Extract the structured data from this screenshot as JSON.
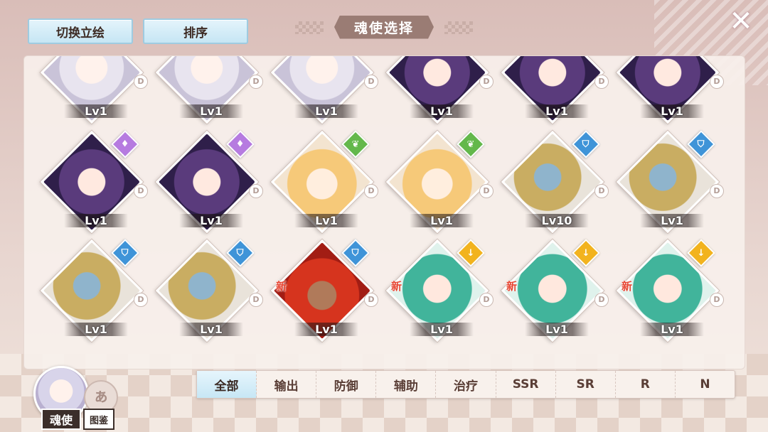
{
  "header": {
    "switch_portrait": "切换立绘",
    "sort": "排序",
    "title": "魂使选择",
    "close": "✕"
  },
  "cards": [
    {
      "level": "Lv1",
      "rank": "D",
      "style": "silver",
      "type": "",
      "type_icon": "",
      "new": ""
    },
    {
      "level": "Lv1",
      "rank": "D",
      "style": "silver",
      "type": "",
      "type_icon": "",
      "new": ""
    },
    {
      "level": "Lv1",
      "rank": "D",
      "style": "silver",
      "type": "",
      "type_icon": "",
      "new": ""
    },
    {
      "level": "Lv1",
      "rank": "D",
      "style": "purple",
      "type": "",
      "type_icon": "",
      "new": ""
    },
    {
      "level": "Lv1",
      "rank": "D",
      "style": "purple",
      "type": "",
      "type_icon": "",
      "new": ""
    },
    {
      "level": "Lv1",
      "rank": "D",
      "style": "purple",
      "type": "",
      "type_icon": "",
      "new": ""
    },
    {
      "level": "Lv1",
      "rank": "D",
      "style": "purple",
      "type": "purple",
      "type_icon": "droplet-icon",
      "new": ""
    },
    {
      "level": "Lv1",
      "rank": "D",
      "style": "purple",
      "type": "purple",
      "type_icon": "droplet-icon",
      "new": ""
    },
    {
      "level": "Lv1",
      "rank": "D",
      "style": "blonde",
      "type": "green",
      "type_icon": "leaf-icon",
      "new": ""
    },
    {
      "level": "Lv1",
      "rank": "D",
      "style": "blonde",
      "type": "green",
      "type_icon": "leaf-icon",
      "new": ""
    },
    {
      "level": "Lv10",
      "rank": "D",
      "style": "armor",
      "type": "blue",
      "type_icon": "shield-icon",
      "new": ""
    },
    {
      "level": "Lv1",
      "rank": "D",
      "style": "armor",
      "type": "blue",
      "type_icon": "shield-icon",
      "new": ""
    },
    {
      "level": "Lv1",
      "rank": "D",
      "style": "armor",
      "type": "blue",
      "type_icon": "shield-icon",
      "new": ""
    },
    {
      "level": "Lv1",
      "rank": "D",
      "style": "armor",
      "type": "blue",
      "type_icon": "shield-icon",
      "new": ""
    },
    {
      "level": "Lv1",
      "rank": "D",
      "style": "red",
      "type": "blue",
      "type_icon": "shield-icon",
      "new": "新"
    },
    {
      "level": "Lv1",
      "rank": "D",
      "style": "green",
      "type": "yellow",
      "type_icon": "sword-icon",
      "new": "新"
    },
    {
      "level": "Lv1",
      "rank": "D",
      "style": "green",
      "type": "yellow",
      "type_icon": "sword-icon",
      "new": "新"
    },
    {
      "level": "Lv1",
      "rank": "D",
      "style": "green",
      "type": "yellow",
      "type_icon": "sword-icon",
      "new": "新"
    }
  ],
  "tabs": [
    "全部",
    "输出",
    "防御",
    "辅助",
    "治疗",
    "SSR",
    "SR",
    "R",
    "N"
  ],
  "bottom": {
    "spirit_label": "魂使",
    "codex_label": "图鉴",
    "codex_glyph": "ぁ"
  },
  "colors": {
    "accent": "#9a7c74",
    "tab_active": "#c7e7f5",
    "new_badge": "#e74532"
  }
}
